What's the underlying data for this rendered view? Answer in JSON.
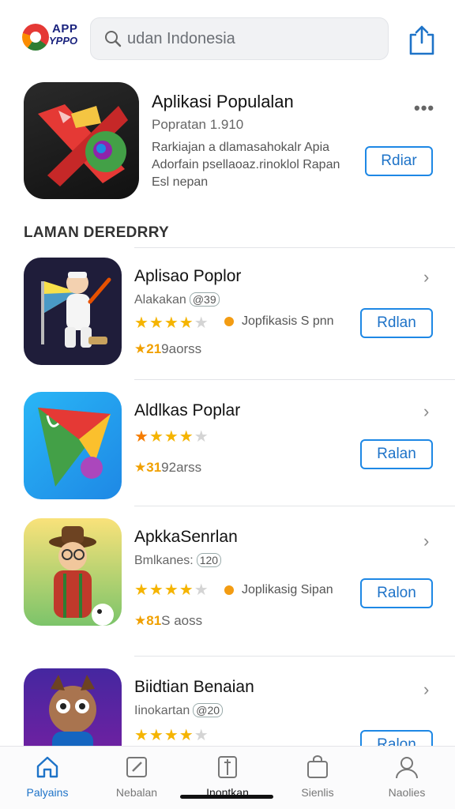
{
  "header": {
    "logo_line1": "APP",
    "logo_line2": "YPPO",
    "search_text": "udan Indonesia"
  },
  "featured": {
    "title": "Aplikasi Populalan",
    "subtitle": "Popratan 1.910",
    "description": "Rarkiajan a dlamasahokalr Apia Adorfain psellaoaz.rinoklol Rapan Esl nepan",
    "button": "Rdiar"
  },
  "section": {
    "title": "LAMAN DEREDRRY"
  },
  "apps": [
    {
      "title": "Aplisao Poplor",
      "subtitle": "Alakakan",
      "pill": "@39",
      "rating": 4,
      "tag": "Jopfikasis S pnn",
      "count_prefix": "★21",
      "count_rest": "9aorss",
      "button": "Rdlan"
    },
    {
      "title": "Aldlkas Poplar",
      "subtitle": "",
      "pill": "",
      "rating": 4,
      "tag": "",
      "count_prefix": "★31",
      "count_rest": "92arss",
      "button": "Ralan"
    },
    {
      "title": "ApkkaSenrlan",
      "subtitle": "Bmlkanes:",
      "pill": "120",
      "rating": 4,
      "tag": "Joplikasig Sipan",
      "count_prefix": "★81",
      "count_rest": "S aoss",
      "button": "Ralon"
    },
    {
      "title": "Biidtian Benaian",
      "subtitle": "Iinokartan",
      "pill": "@20",
      "rating": 4,
      "tag": "",
      "count_prefix": "",
      "count_rest": "",
      "button": "Ralon"
    }
  ],
  "nav": [
    {
      "label": "Palyains",
      "icon": "home-icon"
    },
    {
      "label": "Nebalan",
      "icon": "edit-icon"
    },
    {
      "label": "Inontkan",
      "icon": "map-icon"
    },
    {
      "label": "Sienlis",
      "icon": "bag-icon"
    },
    {
      "label": "Naolies",
      "icon": "profile-icon"
    }
  ],
  "colors": {
    "accent": "#1e88e5",
    "star": "#f5b400"
  }
}
